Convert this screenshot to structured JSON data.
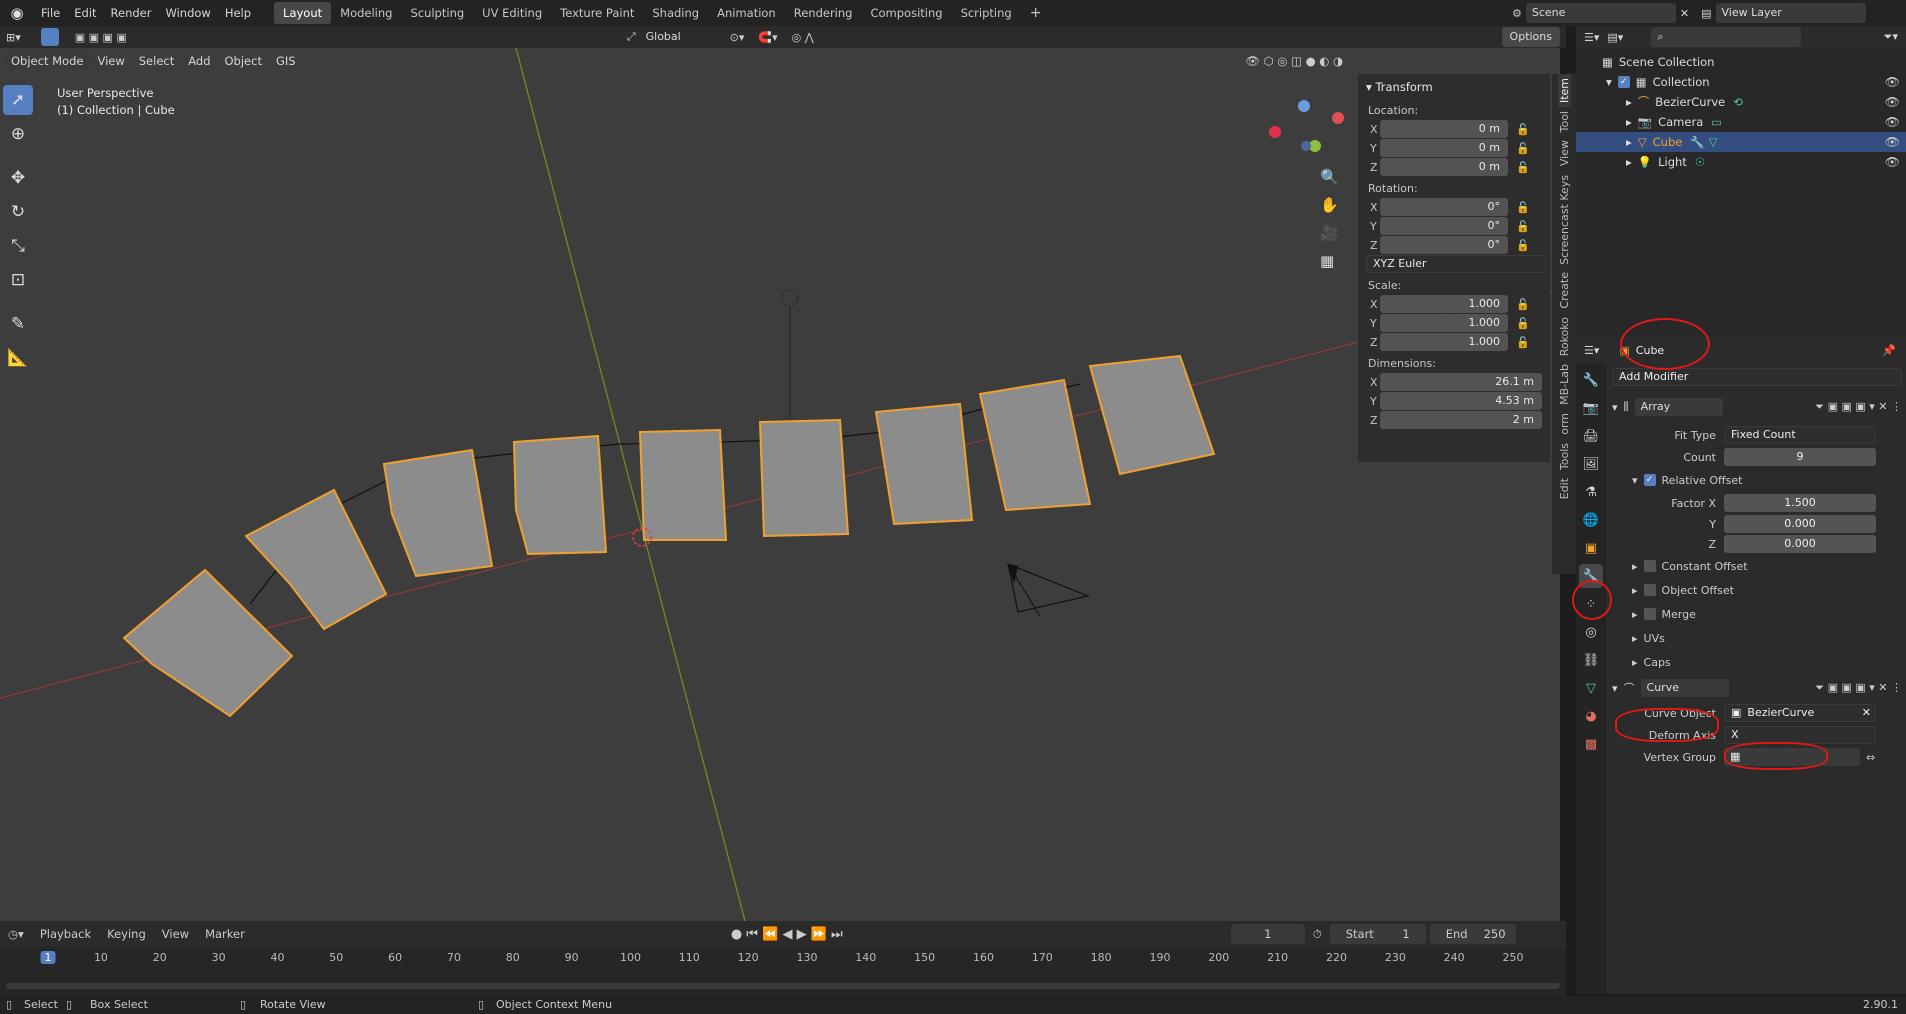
{
  "menus": [
    "File",
    "Edit",
    "Render",
    "Window",
    "Help"
  ],
  "workspaces": [
    "Layout",
    "Modeling",
    "Sculpting",
    "UV Editing",
    "Texture Paint",
    "Shading",
    "Animation",
    "Rendering",
    "Compositing",
    "Scripting"
  ],
  "active_workspace": "Layout",
  "scene": "Scene",
  "view_layer": "View Layer",
  "header": {
    "orientation": "Global",
    "options": "Options"
  },
  "viewport_menu": {
    "mode": "Object Mode",
    "items": [
      "View",
      "Select",
      "Add",
      "Object",
      "GIS"
    ]
  },
  "viewport_info": {
    "line1": "User Perspective",
    "line2": "(1) Collection | Cube"
  },
  "npanel": {
    "title": "Transform",
    "location_label": "Location:",
    "location": {
      "x": "0 m",
      "y": "0 m",
      "z": "0 m"
    },
    "rotation_label": "Rotation:",
    "rotation": {
      "x": "0°",
      "y": "0°",
      "z": "0°"
    },
    "rotation_mode": "XYZ Euler",
    "scale_label": "Scale:",
    "scale": {
      "x": "1.000",
      "y": "1.000",
      "z": "1.000"
    },
    "dimensions_label": "Dimensions:",
    "dimensions": {
      "x": "26.1 m",
      "y": "4.53 m",
      "z": "2 m"
    },
    "axis_x": "X",
    "axis_y": "Y",
    "axis_z": "Z",
    "tabs": [
      "Item",
      "Tool",
      "View",
      "Screencast Keys",
      "Create",
      "Rokoko",
      "MB-Lab",
      "orm",
      "Tools",
      "Edit"
    ]
  },
  "outliner": {
    "root": "Scene Collection",
    "collection": "Collection",
    "items": [
      "BezierCurve",
      "Camera",
      "Cube",
      "Light"
    ],
    "selected": "Cube"
  },
  "properties": {
    "object_name": "Cube",
    "add_modifier": "Add Modifier",
    "array": {
      "name": "Array",
      "fit_type_label": "Fit Type",
      "fit_type": "Fixed Count",
      "count_label": "Count",
      "count": "9",
      "relative_offset": "Relative Offset",
      "factor_x_label": "Factor X",
      "factor_x": "1.500",
      "factor_y_label": "Y",
      "factor_y": "0.000",
      "factor_z_label": "Z",
      "factor_z": "0.000",
      "constant_offset": "Constant Offset",
      "object_offset": "Object Offset",
      "merge": "Merge",
      "uvs": "UVs",
      "caps": "Caps"
    },
    "curve": {
      "name": "Curve",
      "curve_object_label": "Curve Object",
      "curve_object": "BezierCurve",
      "deform_axis_label": "Deform Axis",
      "deform_axis": "X",
      "vertex_group_label": "Vertex Group"
    }
  },
  "timeline": {
    "menus": [
      "Playback",
      "Keying",
      "View",
      "Marker"
    ],
    "current_frame": "1",
    "start_label": "Start",
    "start": "1",
    "end_label": "End",
    "end": "250",
    "ticks": [
      "1",
      "10",
      "20",
      "30",
      "40",
      "50",
      "60",
      "70",
      "80",
      "90",
      "100",
      "110",
      "120",
      "130",
      "140",
      "150",
      "160",
      "170",
      "180",
      "190",
      "200",
      "210",
      "220",
      "230",
      "240",
      "250"
    ]
  },
  "status": {
    "select": "Select",
    "box_select": "Box Select",
    "rotate_view": "Rotate View",
    "context_menu": "Object Context Menu",
    "version": "2.90.1"
  },
  "colors": {
    "accent": "#5680c2",
    "selected_outline": "#f0a030",
    "annotation": "#e01818",
    "x_axis": "#b84545",
    "y_axis": "#7aa02a"
  }
}
